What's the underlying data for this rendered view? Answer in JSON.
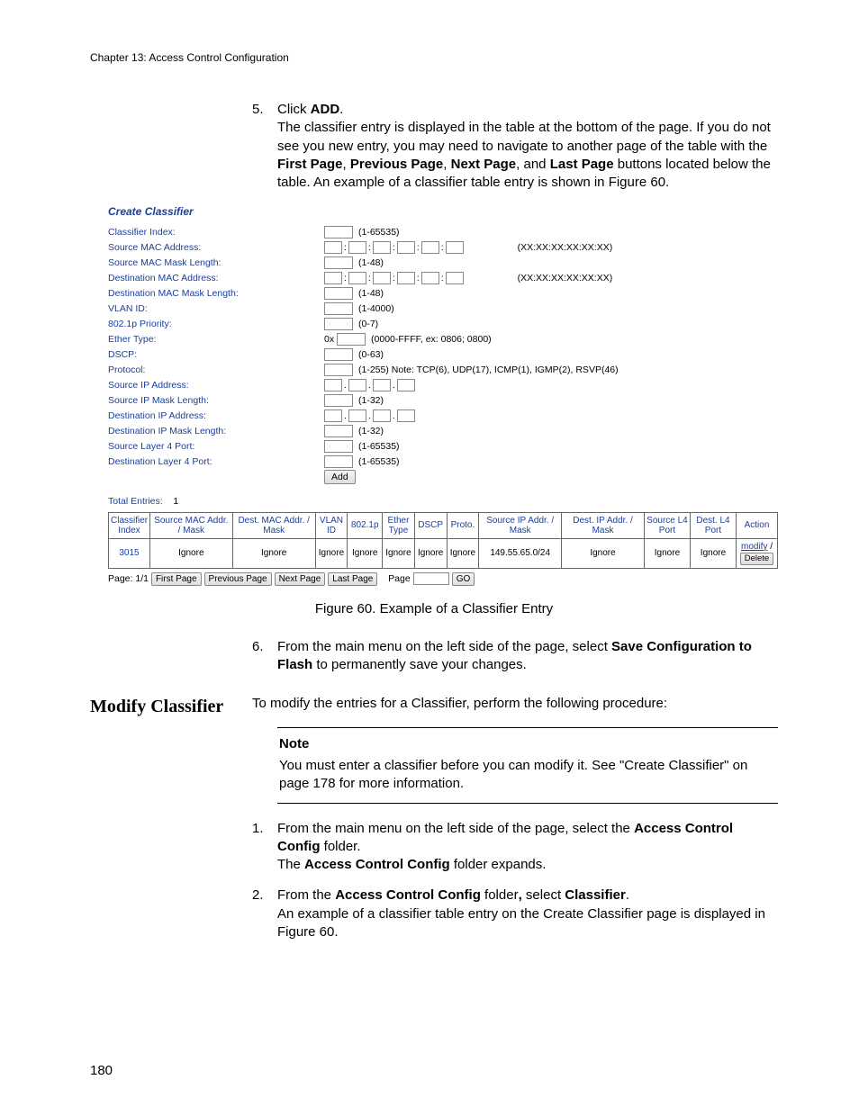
{
  "header": {
    "chapter": "Chapter 13: Access Control Configuration"
  },
  "step5": {
    "num": "5.",
    "line1_a": "Click ",
    "line1_b": "ADD",
    "line1_c": ".",
    "body_a": "The classifier entry is displayed in the table at the bottom of the page. If you do not see you new entry, you may need to navigate to another page of the table with the ",
    "body_first": "First Page",
    "body_sep1": ", ",
    "body_prev": "Previous Page",
    "body_sep2": ", ",
    "body_next": "Next Page",
    "body_sep3": ", and ",
    "body_last": "Last Page",
    "body_tail": " buttons located below the table. An example of a classifier table entry is shown in Figure 60."
  },
  "screenshot": {
    "title": "Create Classifier",
    "labels": {
      "ci": "Classifier Index:",
      "smac": "Source MAC Address:",
      "smask": "Source MAC Mask Length:",
      "dmac": "Destination MAC Address:",
      "dmask": "Destination MAC Mask Length:",
      "vlan": "VLAN ID:",
      "pri": "802.1p Priority:",
      "eth": "Ether Type:",
      "dscp": "DSCP:",
      "proto": "Protocol:",
      "sip": "Source IP Address:",
      "simask": "Source IP Mask Length:",
      "dip": "Destination IP Address:",
      "dimask": "Destination IP Mask Length:",
      "sl4": "Source Layer 4 Port:",
      "dl4": "Destination Layer 4 Port:"
    },
    "hints": {
      "ci": "(1-65535)",
      "mac_fmt": "(XX:XX:XX:XX:XX:XX)",
      "mask48": "(1-48)",
      "vlan": "(1-4000)",
      "pri": "(0-7)",
      "eth_pre": "0x",
      "eth": "(0000-FFFF, ex: 0806; 0800)",
      "dscp": "(0-63)",
      "proto": "(1-255) Note: TCP(6), UDP(17), ICMP(1), IGMP(2), RSVP(46)",
      "mask32": "(1-32)",
      "port": "(1-65535)"
    },
    "add": "Add",
    "total_lbl": "Total Entries:",
    "total_val": "1",
    "thead": {
      "ci": "Classifier Index",
      "smac": "Source MAC Addr. / Mask",
      "dmac": "Dest. MAC Addr. / Mask",
      "vlan": "VLAN ID",
      "pri": "802.1p",
      "eth": "Ether Type",
      "dscp": "DSCP",
      "proto": "Proto.",
      "sip": "Source IP Addr. / Mask",
      "dip": "Dest. IP Addr. / Mask",
      "sl4": "Source L4 Port",
      "dl4": "Dest. L4 Port",
      "act": "Action"
    },
    "row": {
      "ci": "3015",
      "smac": "Ignore",
      "dmac": "Ignore",
      "vlan": "Ignore",
      "pri": "Ignore",
      "eth": "Ignore",
      "dscp": "Ignore",
      "proto": "Ignore",
      "sip": "149.55.65.0/24",
      "dip": "Ignore",
      "sl4": "Ignore",
      "dl4": "Ignore",
      "modify": "modify",
      "slash": " / ",
      "delete": "Delete"
    },
    "pager": {
      "pg": "Page: 1/1",
      "first": "First Page",
      "prev": "Previous Page",
      "next": "Next Page",
      "last": "Last Page",
      "page_lbl": "Page",
      "go": "GO"
    }
  },
  "figcap": "Figure 60. Example of a Classifier Entry",
  "step6": {
    "num": "6.",
    "a": "From the main menu on the left side of the page, select ",
    "b": "Save Configuration to Flash",
    "c": " to permanently save your changes."
  },
  "modify_section": {
    "heading": "Modify Classifier",
    "intro": "To modify the entries for a Classifier, perform the following procedure:",
    "note_title": "Note",
    "note_body": "You must enter a classifier before you can modify it. See \"Create Classifier\" on page 178 for more information.",
    "s1": {
      "num": "1.",
      "a": "From the main menu on the left side of the page, select the ",
      "b": "Access Control Config",
      "c": " folder.",
      "d_a": "The ",
      "d_b": "Access Control Config",
      "d_c": " folder expands."
    },
    "s2": {
      "num": "2.",
      "a": "From the ",
      "b": "Access Control Config",
      "c": " folder",
      "comma": ", ",
      "d": "select ",
      "e": "Classifier",
      "f": ".",
      "g": "An example of a classifier table entry on the Create Classifier page is displayed in Figure 60."
    }
  },
  "page_number": "180"
}
